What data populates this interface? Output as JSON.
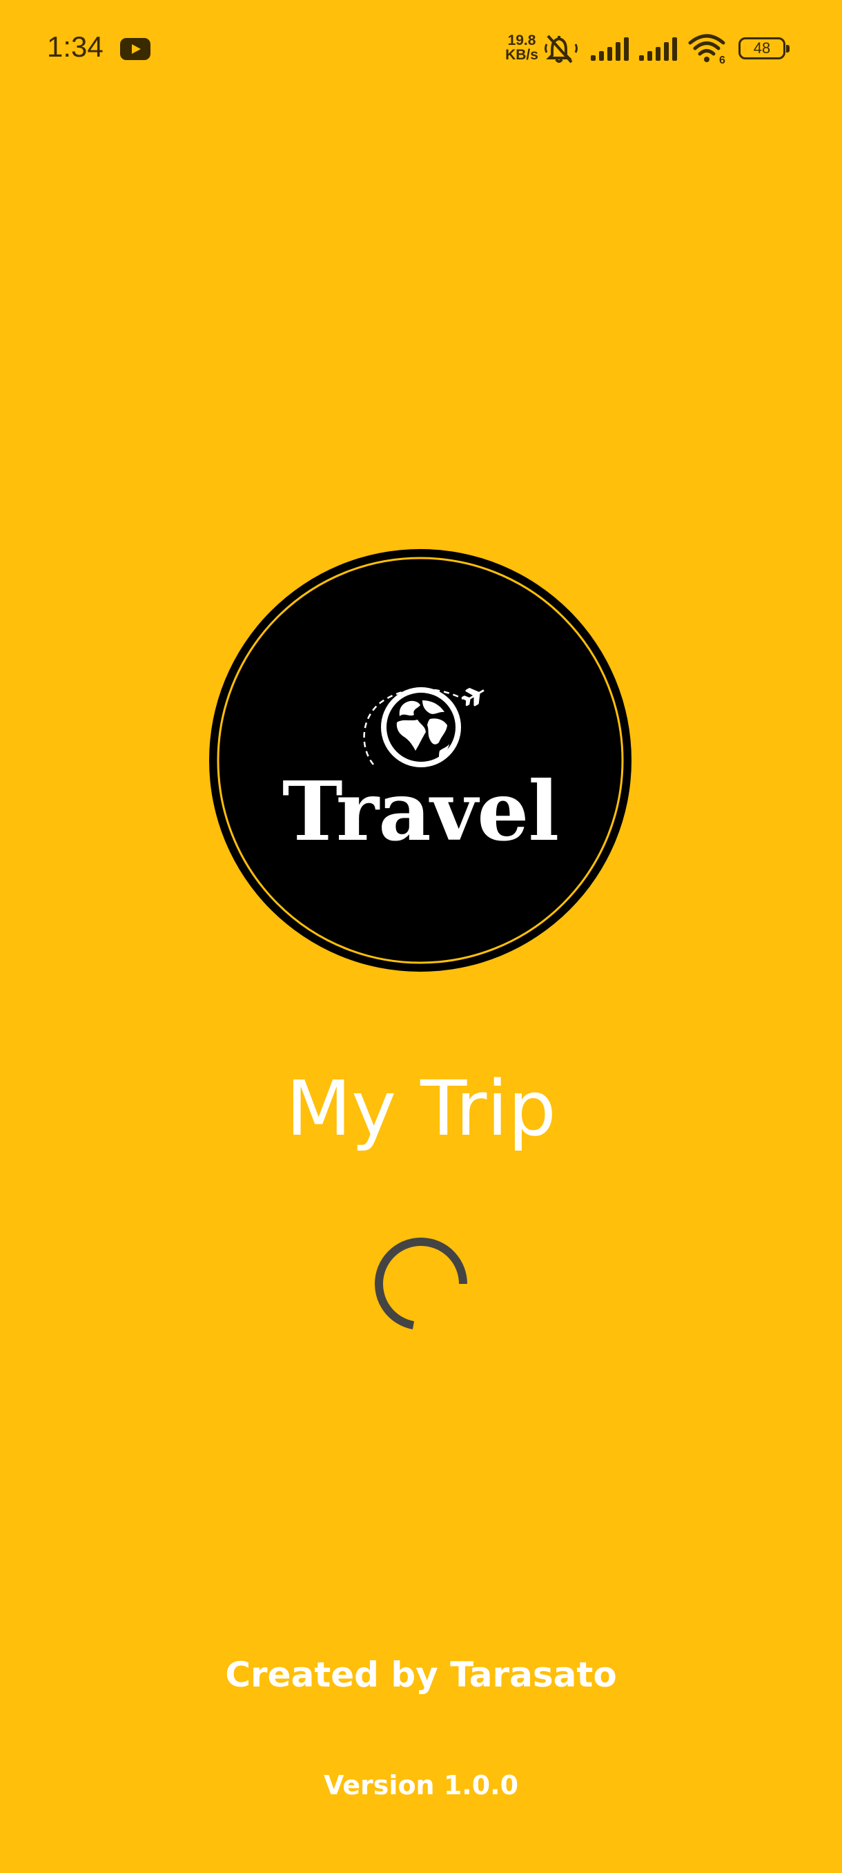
{
  "status_bar": {
    "time": "1:34",
    "net_speed_value": "19.8",
    "net_speed_unit": "KB/s",
    "battery_level": "48",
    "icons": [
      "youtube-icon",
      "mute-icon",
      "signal-icon",
      "signal-icon",
      "wifi-icon",
      "battery-icon"
    ]
  },
  "logo": {
    "text": "Travel",
    "icons": [
      "globe-icon",
      "airplane-icon"
    ]
  },
  "app": {
    "title": "My Trip"
  },
  "footer": {
    "credit": "Created by Tarasato",
    "version": "Version 1.0.0"
  },
  "colors": {
    "background": "#FFBF0A",
    "logo_fill": "#000000",
    "text": "#FFFFFF",
    "spinner": "#444444"
  }
}
